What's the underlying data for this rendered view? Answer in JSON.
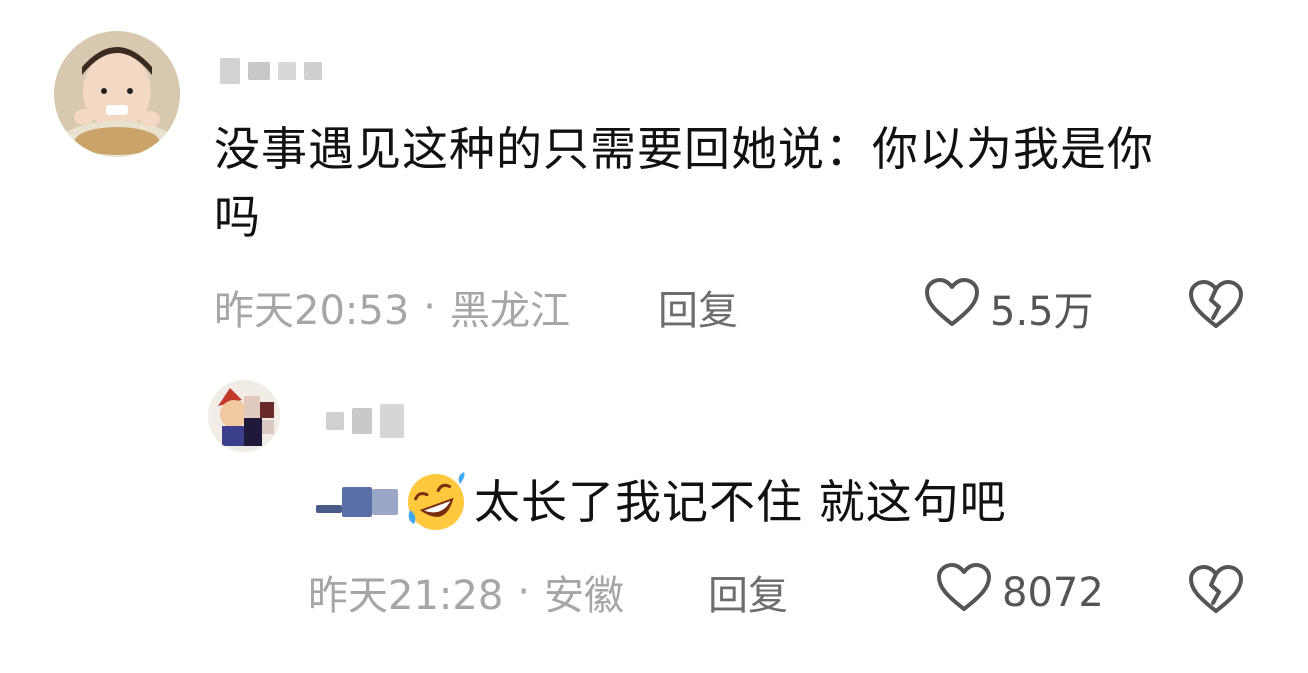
{
  "comments": [
    {
      "text_line1": "没事遇见这种的只需要回她说：你以为我是你",
      "text_line2": "吗",
      "time": "昨天20:53",
      "separator": "·",
      "location": "黑龙江",
      "reply_label": "回复",
      "like_count": "5.5万"
    },
    {
      "text": "太长了我记不住 就这句吧",
      "time": "昨天21:28",
      "separator": "·",
      "location": "安徽",
      "reply_label": "回复",
      "like_count": "8072"
    }
  ],
  "icons": {
    "like": "heart-outline-icon",
    "dislike": "broken-heart-icon",
    "emoji": "rofl-emoji-icon"
  },
  "colors": {
    "meta_text": "#a6a6a6",
    "reply_text": "#6d6d6d",
    "main_text": "#111111",
    "icon": "#555555"
  }
}
